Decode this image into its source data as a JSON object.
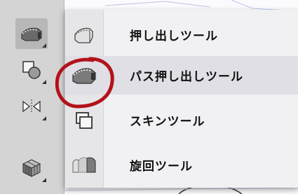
{
  "menu": {
    "items": [
      {
        "label": "押し出しツール",
        "icon": "extrude-tool-icon"
      },
      {
        "label": "パス押し出しツール",
        "icon": "path-extrude-tool-icon"
      },
      {
        "label": "スキンツール",
        "icon": "skin-tool-icon"
      },
      {
        "label": "旋回ツール",
        "icon": "lathe-tool-icon"
      }
    ],
    "highlighted_index": 1
  },
  "toolbar": {
    "tools": [
      "extrude-tool-icon",
      "shapes-tool-icon",
      "mirror-tool-icon",
      "cube-tool-icon"
    ],
    "active_index": 0
  },
  "colors": {
    "annotation": "#b3121b",
    "menu_bg": "#f1f1f3",
    "menu_highlight": "#dfdfe5",
    "panel_bg": "#d4d4d4"
  }
}
